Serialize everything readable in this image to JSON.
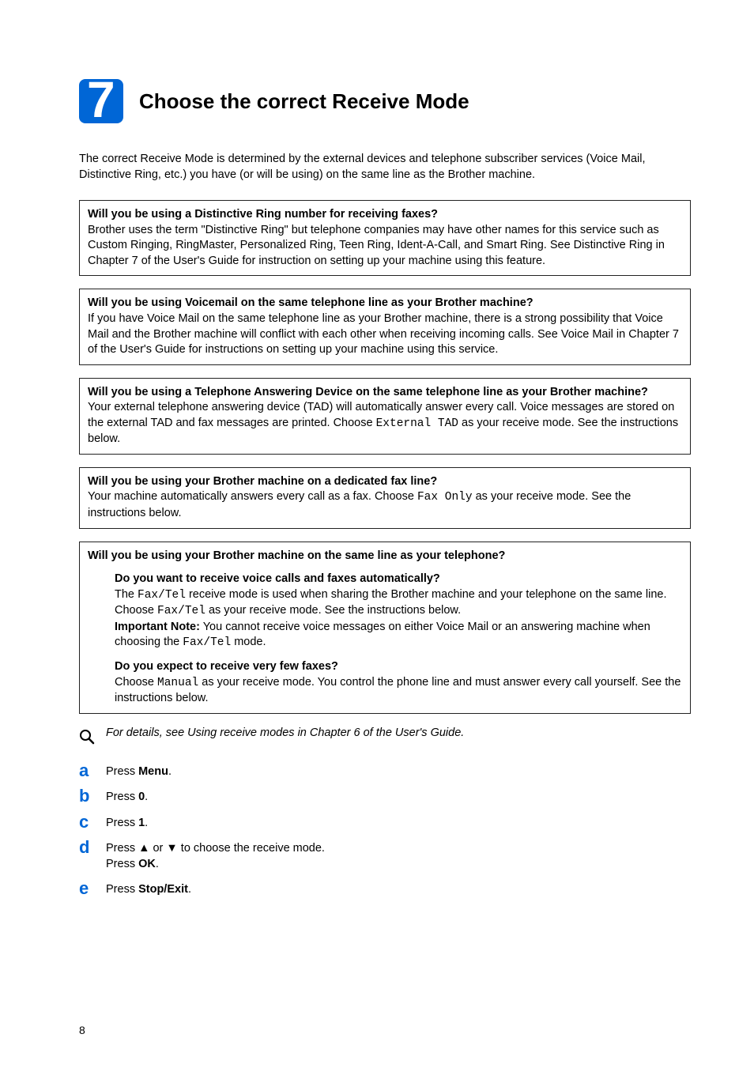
{
  "step": {
    "number": "7",
    "title": "Choose the correct Receive Mode"
  },
  "intro": "The correct Receive Mode is determined by the external devices and telephone subscriber services (Voice Mail, Distinctive Ring, etc.) you have (or will be using) on the same line as the Brother machine.",
  "boxes": {
    "b1": {
      "q": "Will you be using a Distinctive Ring number for receiving faxes?",
      "a": "Brother uses the term \"Distinctive Ring\" but telephone companies may have other names for this service such as Custom Ringing, RingMaster, Personalized Ring, Teen Ring, Ident-A-Call, and Smart Ring. See Distinctive Ring in Chapter 7 of the User's Guide for instruction on setting up your machine using this feature."
    },
    "b2": {
      "q": "Will you be using Voicemail on the same telephone line as your Brother machine?",
      "a": "If you have Voice Mail on the same telephone line as your Brother machine, there is a strong possibility that Voice Mail and the Brother machine will conflict with each other when receiving incoming calls. See Voice Mail in Chapter 7 of the User's Guide for instructions on setting up your machine using this service."
    },
    "b3": {
      "q": "Will you be using a Telephone Answering Device on the same telephone line as your Brother machine?",
      "a1": "Your external telephone answering device (TAD) will automatically answer every call. Voice messages are stored on the external TAD and fax messages are printed. Choose ",
      "code": "External TAD",
      "a2": " as your receive mode. See the instructions below."
    },
    "b4": {
      "q": "Will you be using your Brother machine on a dedicated fax line?",
      "a1": "Your machine automatically answers every call as a fax. Choose ",
      "code": "Fax Only",
      "a2": " as your receive mode. See the instructions below."
    },
    "b5": {
      "q": "Will you be using your Brother machine on the same line as your telephone?",
      "sub1": {
        "q": "Do you want to receive voice calls and faxes automatically?",
        "l1a": "The ",
        "l1code": "Fax/Tel",
        "l1b": " receive mode is used when sharing the Brother machine and your telephone on the same line. Choose ",
        "l1code2": "Fax/Tel",
        "l1c": " as your receive mode. See the instructions below.",
        "noteLabel": "Important Note:",
        "noteA": " You cannot receive voice messages on either Voice Mail or an answering machine when choosing the ",
        "noteCode": "Fax/Tel",
        "noteB": " mode."
      },
      "sub2": {
        "q": "Do you expect to receive very few faxes?",
        "l1a": "Choose ",
        "l1code": "Manual",
        "l1b": " as your receive mode. You control the phone line and must answer every call yourself. See the instructions below."
      }
    }
  },
  "note": "For details, see Using receive modes in Chapter 6 of the User's Guide.",
  "letters": {
    "a": "a",
    "b": "b",
    "c": "c",
    "d": "d",
    "e": "e"
  },
  "stepsText": {
    "a1": "Press ",
    "a2": "Menu",
    "a3": ".",
    "b1": "Press ",
    "b2": "0",
    "b3": ".",
    "c1": "Press ",
    "c2": "1",
    "c3": ".",
    "d1a": "Press ",
    "d1b": " or ",
    "d1c": " to choose the receive mode.",
    "d2a": "Press ",
    "d2b": "OK",
    "d2c": ".",
    "e1": "Press ",
    "e2": "Stop/Exit",
    "e3": "."
  },
  "arrows": {
    "up": "▲",
    "down": "▼"
  },
  "pagenum": "8"
}
